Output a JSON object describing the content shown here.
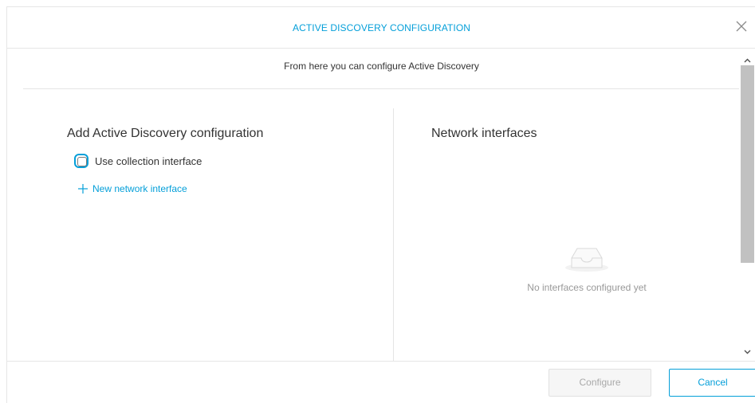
{
  "dialog": {
    "title": "ACTIVE DISCOVERY CONFIGURATION",
    "close_icon": "close-icon",
    "subtitle": "From here you can configure Active Discovery"
  },
  "left_panel": {
    "heading": "Add Active Discovery configuration",
    "checkbox_label": "Use collection interface",
    "checkbox_checked": false,
    "add_link_label": "New network interface",
    "add_link_icon": "plus-icon"
  },
  "right_panel": {
    "heading": "Network interfaces",
    "empty_icon": "empty-inbox-icon",
    "empty_text": "No interfaces configured yet"
  },
  "footer": {
    "configure_label": "Configure",
    "configure_disabled": true,
    "cancel_label": "Cancel"
  },
  "colors": {
    "accent": "#049fd9",
    "text": "#333333",
    "muted": "#999999",
    "border": "#e5e5e5"
  }
}
